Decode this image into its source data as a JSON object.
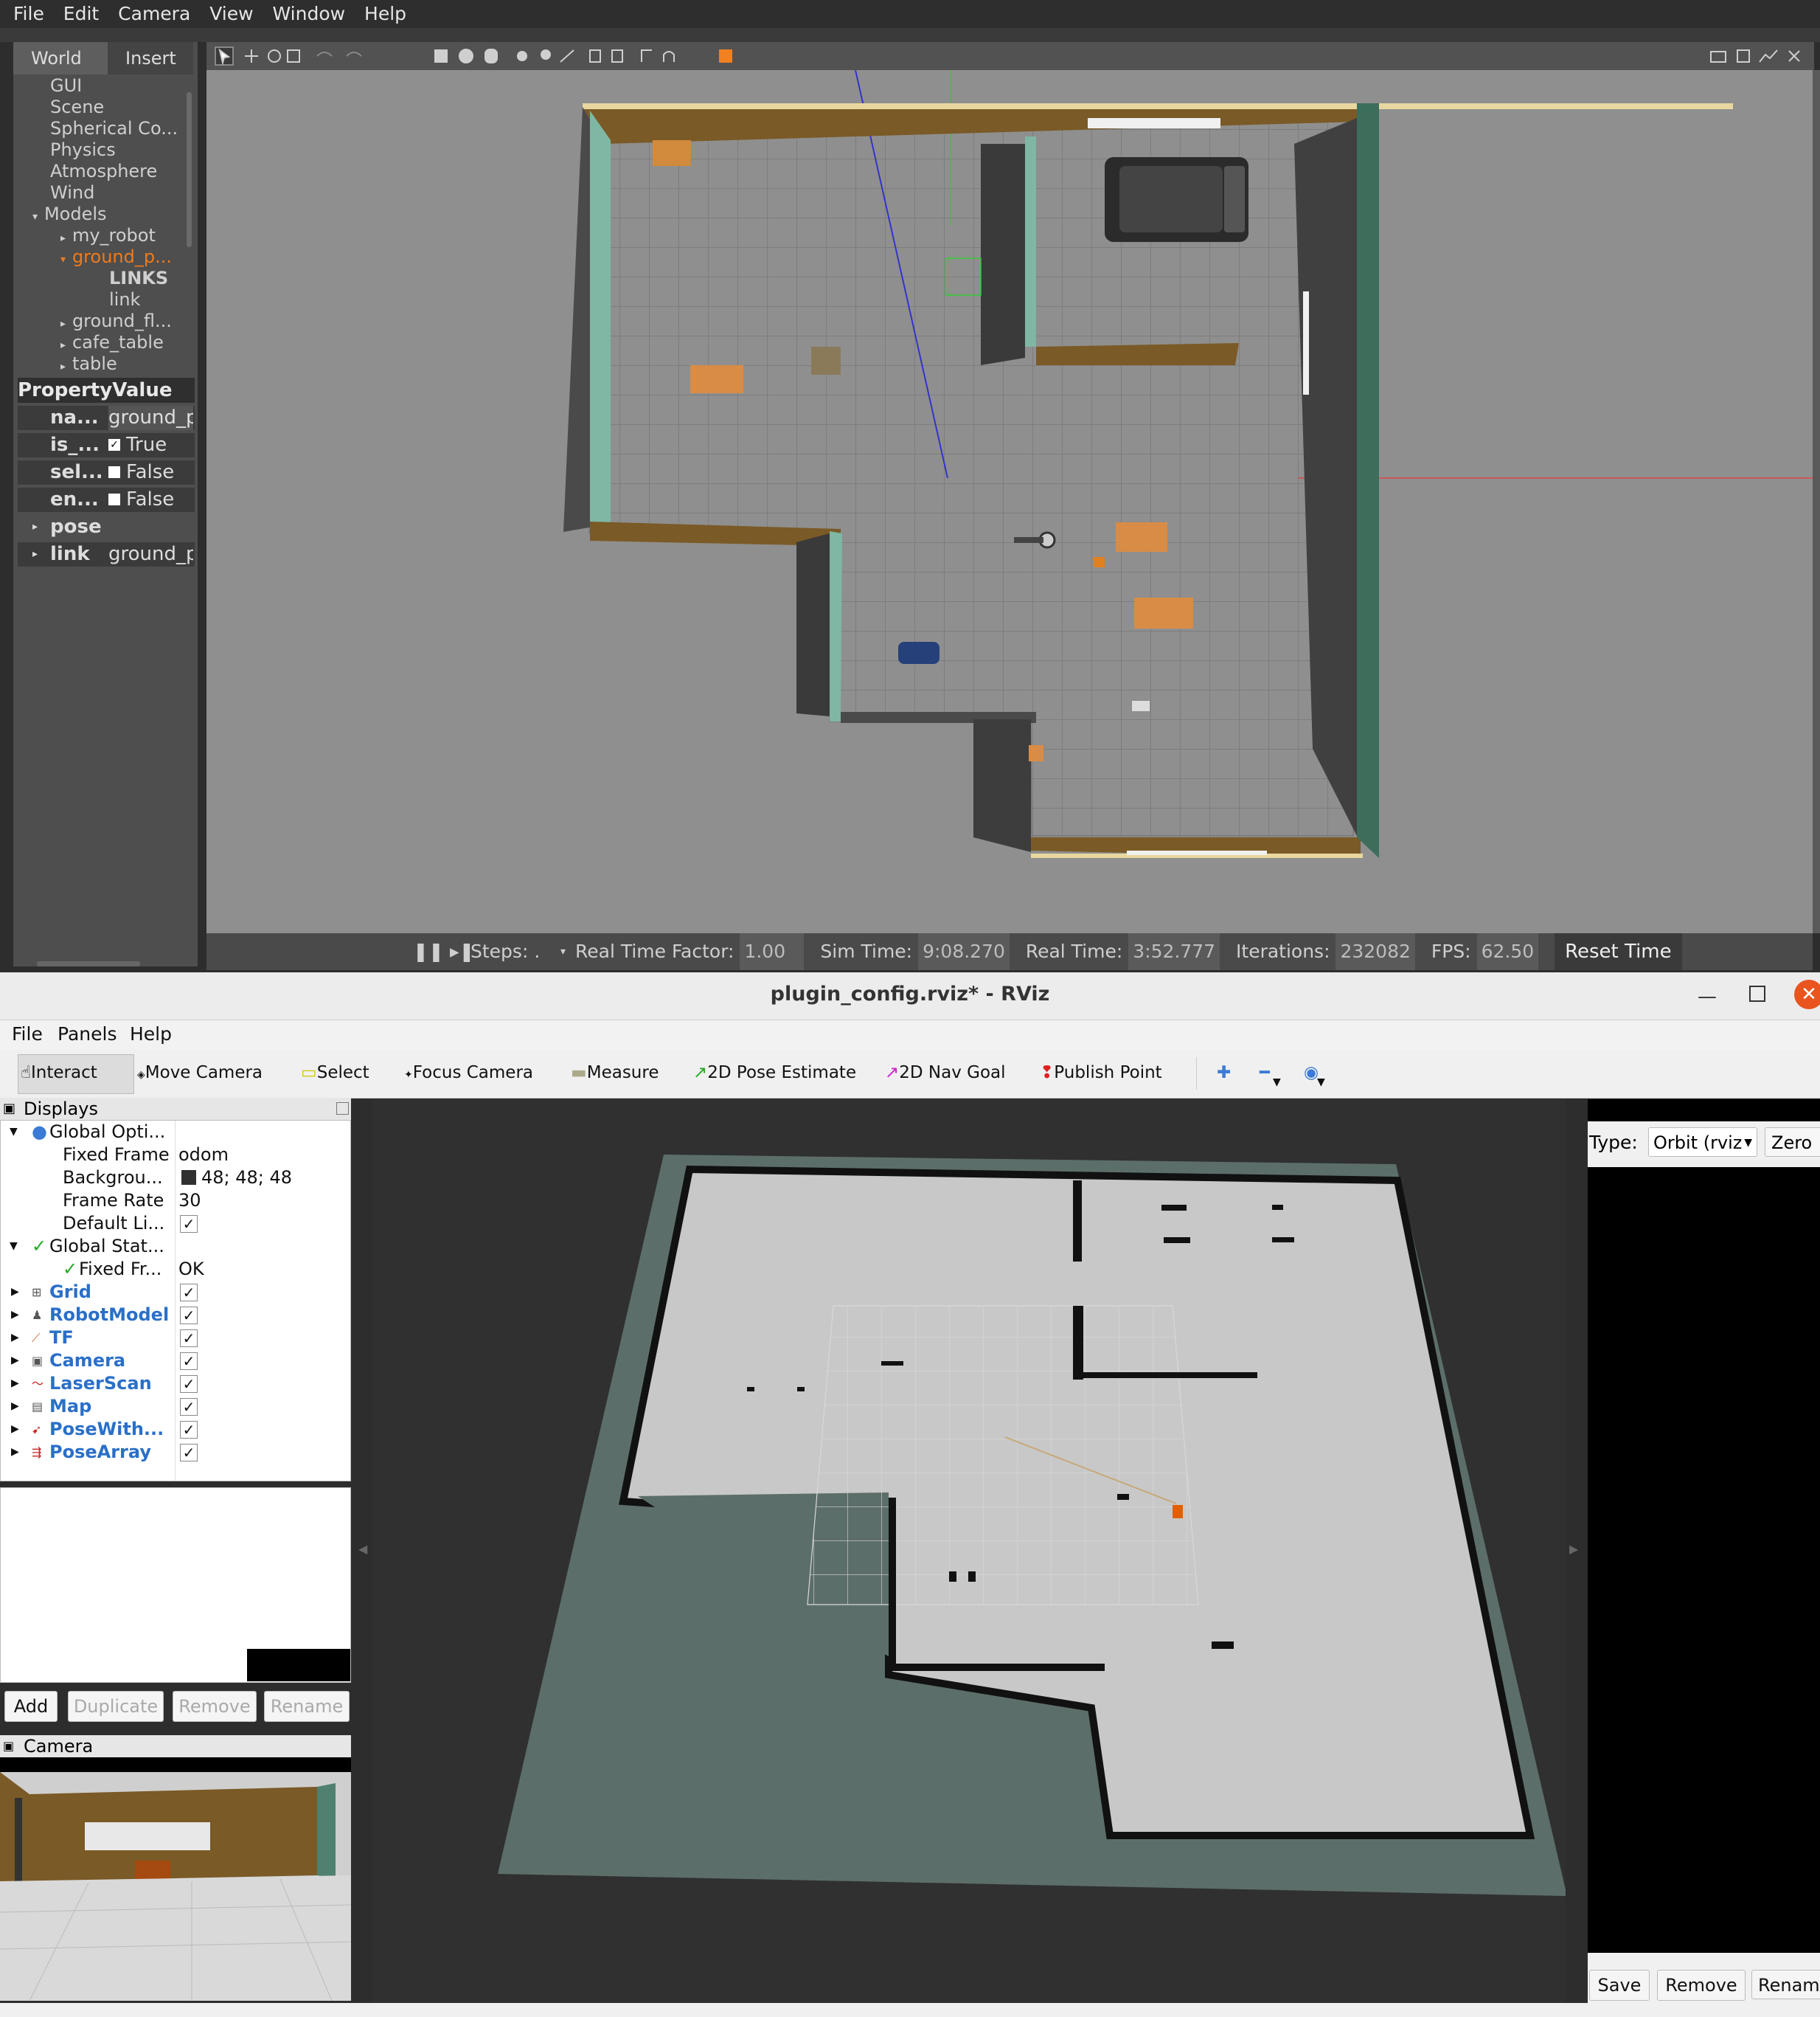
{
  "gazebo": {
    "menu": [
      "File",
      "Edit",
      "Camera",
      "View",
      "Window",
      "Help"
    ],
    "tabs": {
      "world": "World",
      "insert": "Insert"
    },
    "tree": {
      "items": [
        "GUI",
        "Scene",
        "Spherical Co...",
        "Physics",
        "Atmosphere",
        "Wind",
        "Models"
      ],
      "models": {
        "my_robot": "my_robot",
        "ground_plane": "ground_p...",
        "links_header": "LINKS",
        "link": "link",
        "ground_floor": "ground_fl...",
        "cafe_table": "cafe_table",
        "table": "table"
      }
    },
    "properties": {
      "header_property": "Property",
      "header_value": "Value",
      "rows": [
        {
          "name": "na...",
          "value": "ground_p"
        },
        {
          "name": "is_...",
          "value": "True",
          "checked": true
        },
        {
          "name": "sel...",
          "value": "False",
          "checked": false
        },
        {
          "name": "en...",
          "value": "False",
          "checked": false
        },
        {
          "name": "pose",
          "value": ""
        },
        {
          "name": "link",
          "value": "ground_p"
        }
      ]
    },
    "status": {
      "steps_label": "Steps: .",
      "rtf_label": "Real Time Factor:",
      "rtf": "1.00",
      "sim_label": "Sim Time:",
      "sim": "9:08.270",
      "real_label": "Real Time:",
      "real": "3:52.777",
      "iter_label": "Iterations:",
      "iter": "232082",
      "fps_label": "FPS:",
      "fps": "62.50",
      "reset": "Reset Time"
    }
  },
  "rviz": {
    "title": "plugin_config.rviz* - RViz",
    "menu": [
      "File",
      "Panels",
      "Help"
    ],
    "tools": [
      "Interact",
      "Move Camera",
      "Select",
      "Focus Camera",
      "Measure",
      "2D Pose Estimate",
      "2D Nav Goal",
      "Publish Point"
    ],
    "displays": {
      "panel_title": "Displays",
      "global_options": "Global Opti...",
      "fixed_frame_label": "Fixed Frame",
      "fixed_frame": "odom",
      "background_label": "Backgrou...",
      "background": "48; 48; 48",
      "frame_rate_label": "Frame Rate",
      "frame_rate": "30",
      "default_light_label": "Default Li...",
      "global_status": "Global Stat...",
      "fixed_status_label": "Fixed Fr...",
      "fixed_status": "OK",
      "items": [
        "Grid",
        "RobotModel",
        "TF",
        "Camera",
        "LaserScan",
        "Map",
        "PoseWith...",
        "PoseArray"
      ]
    },
    "buttons": {
      "add": "Add",
      "duplicate": "Duplicate",
      "remove": "Remove",
      "rename": "Rename"
    },
    "camera_panel_title": "Camera",
    "views": {
      "type_label": "Type:",
      "type_value": "Orbit (rviz",
      "zero": "Zero",
      "save": "Save",
      "remove": "Remove",
      "rename": "Rename"
    },
    "colors": {
      "background": "#303030",
      "accent": "#2a6fc9"
    }
  }
}
